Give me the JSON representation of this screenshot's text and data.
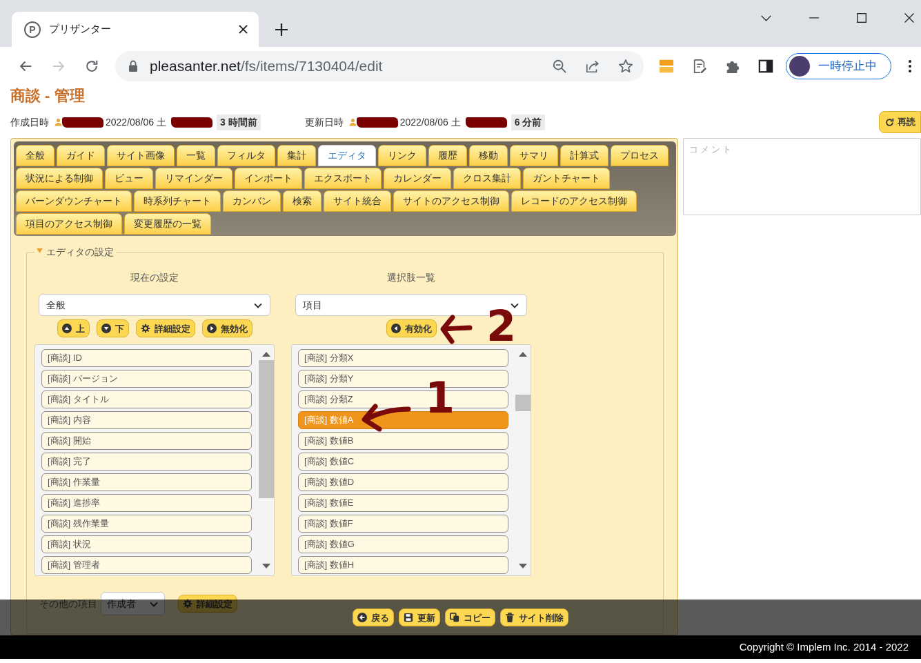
{
  "browser": {
    "favicon_letter": "P",
    "tab_title": "プリザンター",
    "url_host": "pleasanter.net",
    "url_path": "/fs/items/7130404/edit",
    "forward_disabled": true,
    "profile_label": "一時停止中"
  },
  "page": {
    "title": "商談 - 管理",
    "reload_button": "再読"
  },
  "record_info": [
    {
      "label": "作成日時",
      "date": "2022/08/06 土",
      "ago": "3 時間前"
    },
    {
      "label": "更新日時",
      "date": "2022/08/06 土",
      "ago": "6 分前"
    }
  ],
  "tab_rows": [
    [
      {
        "label": "全般",
        "selected": false
      },
      {
        "label": "ガイド",
        "selected": false
      },
      {
        "label": "サイト画像",
        "selected": false
      },
      {
        "label": "一覧",
        "selected": false
      },
      {
        "label": "フィルタ",
        "selected": false
      },
      {
        "label": "集計",
        "selected": false
      },
      {
        "label": "エディタ",
        "selected": true
      },
      {
        "label": "リンク",
        "selected": false
      },
      {
        "label": "履歴",
        "selected": false
      },
      {
        "label": "移動",
        "selected": false
      },
      {
        "label": "サマリ",
        "selected": false
      },
      {
        "label": "計算式",
        "selected": false
      },
      {
        "label": "プロセス",
        "selected": false
      }
    ],
    [
      {
        "label": "状況による制御",
        "selected": false
      },
      {
        "label": "ビュー",
        "selected": false
      },
      {
        "label": "リマインダー",
        "selected": false
      },
      {
        "label": "インポート",
        "selected": false
      },
      {
        "label": "エクスポート",
        "selected": false
      },
      {
        "label": "カレンダー",
        "selected": false
      },
      {
        "label": "クロス集計",
        "selected": false
      },
      {
        "label": "ガントチャート",
        "selected": false
      }
    ],
    [
      {
        "label": "バーンダウンチャート",
        "selected": false
      },
      {
        "label": "時系列チャート",
        "selected": false
      },
      {
        "label": "カンバン",
        "selected": false
      },
      {
        "label": "検索",
        "selected": false
      },
      {
        "label": "サイト統合",
        "selected": false
      },
      {
        "label": "サイトのアクセス制御",
        "selected": false
      },
      {
        "label": "レコードのアクセス制御",
        "selected": false
      }
    ],
    [
      {
        "label": "項目のアクセス制御",
        "selected": false
      },
      {
        "label": "変更履歴の一覧",
        "selected": false
      }
    ]
  ],
  "editor_settings": {
    "legend": "エディタの設定",
    "expanded": true,
    "columns": [
      {
        "heading": "現在の設定",
        "select": "全般",
        "buttons": [
          {
            "label": "上",
            "kind": "up"
          },
          {
            "label": "下",
            "kind": "down"
          },
          {
            "label": "詳細設定",
            "kind": "gear"
          },
          {
            "label": "無効化",
            "kind": "right"
          }
        ],
        "items": [
          {
            "label": "[商談] ID",
            "selected": false
          },
          {
            "label": "[商談] バージョン",
            "selected": false
          },
          {
            "label": "[商談] タイトル",
            "selected": false
          },
          {
            "label": "[商談] 内容",
            "selected": false
          },
          {
            "label": "[商談] 開始",
            "selected": false
          },
          {
            "label": "[商談] 完了",
            "selected": false
          },
          {
            "label": "[商談] 作業量",
            "selected": false
          },
          {
            "label": "[商談] 進捗率",
            "selected": false
          },
          {
            "label": "[商談] 残作業量",
            "selected": false
          },
          {
            "label": "[商談] 状況",
            "selected": false
          },
          {
            "label": "[商談] 管理者",
            "selected": false
          }
        ]
      },
      {
        "heading": "選択肢一覧",
        "select": "項目",
        "buttons": [
          {
            "label": "有効化",
            "kind": "left"
          }
        ],
        "items": [
          {
            "label": "[商談] 分類X",
            "selected": false
          },
          {
            "label": "[商談] 分類Y",
            "selected": false
          },
          {
            "label": "[商談] 分類Z",
            "selected": false
          },
          {
            "label": "[商談] 数値A",
            "selected": true
          },
          {
            "label": "[商談] 数値B",
            "selected": false
          },
          {
            "label": "[商談] 数値C",
            "selected": false
          },
          {
            "label": "[商談] 数値D",
            "selected": false
          },
          {
            "label": "[商談] 数値E",
            "selected": false
          },
          {
            "label": "[商談] 数値F",
            "selected": false
          },
          {
            "label": "[商談] 数値G",
            "selected": false
          },
          {
            "label": "[商談] 数値H",
            "selected": false
          }
        ]
      }
    ],
    "other": {
      "label": "その他の項目",
      "select": "作成者",
      "button": {
        "label": "詳細設定",
        "kind": "gear"
      }
    }
  },
  "comment": {
    "placeholder": "コメント"
  },
  "command_bar": [
    {
      "label": "戻る",
      "kind": "back"
    },
    {
      "label": "更新",
      "kind": "save"
    },
    {
      "label": "コピー",
      "kind": "copy"
    },
    {
      "label": "サイト削除",
      "kind": "trash"
    }
  ],
  "footer": {
    "copyright": "Copyright © Implem Inc. 2014 - 2022"
  },
  "annotations": [
    {
      "label": "2"
    },
    {
      "label": "1"
    }
  ]
}
